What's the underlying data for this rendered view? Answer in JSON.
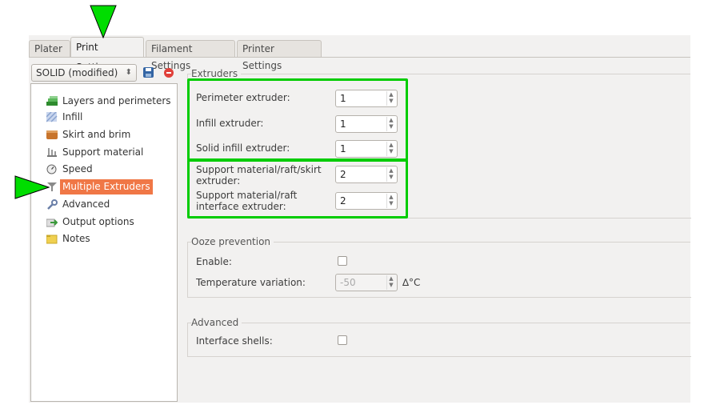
{
  "tabs": [
    "Plater",
    "Print Settings",
    "Filament Settings",
    "Printer Settings"
  ],
  "preset": {
    "value": "SOLID (modified)"
  },
  "tree": [
    {
      "label": "Layers and perimeters",
      "icon": "layers-icon",
      "color": "#2e8b2e"
    },
    {
      "label": "Infill",
      "icon": "infill-icon",
      "color": "#9db3d9"
    },
    {
      "label": "Skirt and brim",
      "icon": "skirt-icon",
      "color": "#c8742c"
    },
    {
      "label": "Support material",
      "icon": "support-icon",
      "color": "#8a8a8a"
    },
    {
      "label": "Speed",
      "icon": "speed-icon",
      "color": "#666666"
    },
    {
      "label": "Multiple Extruders",
      "icon": "funnel-icon",
      "color": "#7a7a7a"
    },
    {
      "label": "Advanced",
      "icon": "wrench-icon",
      "color": "#6a7fa8"
    },
    {
      "label": "Output options",
      "icon": "output-icon",
      "color": "#3a9a3a"
    },
    {
      "label": "Notes",
      "icon": "notes-icon",
      "color": "#e8c440"
    }
  ],
  "groups": {
    "extruders": {
      "title": "Extruders",
      "fields": [
        {
          "label": "Perimeter extruder:",
          "value": "1"
        },
        {
          "label": "Infill extruder:",
          "value": "1"
        },
        {
          "label": "Solid infill extruder:",
          "value": "1"
        },
        {
          "label": "Support material/raft/skirt extruder:",
          "value": "2"
        },
        {
          "label": "Support material/raft interface extruder:",
          "value": "2"
        }
      ]
    },
    "ooze": {
      "title": "Ooze prevention",
      "enable_label": "Enable:",
      "temp_label": "Temperature variation:",
      "temp_value": "-50",
      "temp_unit": "∆°C"
    },
    "advanced": {
      "title": "Advanced",
      "interface_label": "Interface shells:"
    }
  },
  "colors": {
    "highlight": "#00cc00",
    "selection": "#f07746"
  }
}
